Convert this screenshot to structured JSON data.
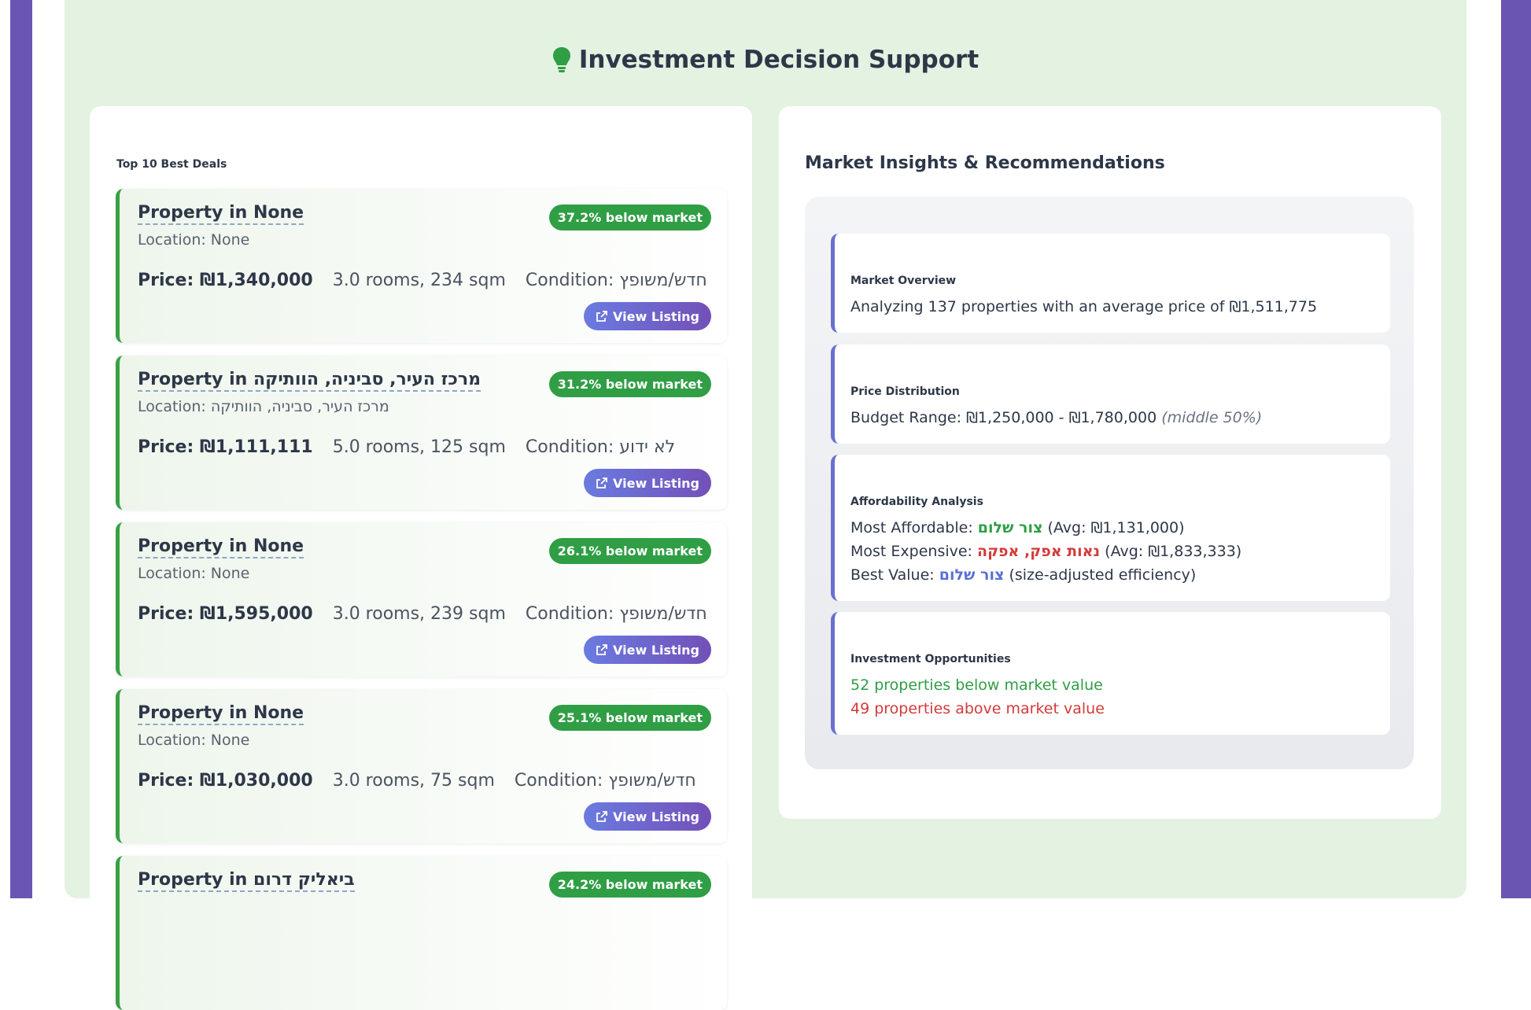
{
  "header": {
    "title": "Investment Decision Support"
  },
  "deals_section": {
    "title": "Top 10 Best Deals",
    "view_label": "View Listing",
    "items": [
      {
        "name": "Property in None",
        "location": "Location: None",
        "badge": "37.2% below market",
        "price": "Price: ₪1,340,000",
        "rooms": "3.0 rooms, 234 sqm",
        "condition": "Condition: חדש/משופץ"
      },
      {
        "name": "Property in מרכז העיר, סביניה, הוותיקה",
        "location": "Location: מרכז העיר, סביניה, הוותיקה",
        "badge": "31.2% below market",
        "price": "Price: ₪1,111,111",
        "rooms": "5.0 rooms, 125 sqm",
        "condition": "Condition: לא ידוע"
      },
      {
        "name": "Property in None",
        "location": "Location: None",
        "badge": "26.1% below market",
        "price": "Price: ₪1,595,000",
        "rooms": "3.0 rooms, 239 sqm",
        "condition": "Condition: חדש/משופץ"
      },
      {
        "name": "Property in None",
        "location": "Location: None",
        "badge": "25.1% below market",
        "price": "Price: ₪1,030,000",
        "rooms": "3.0 rooms, 75 sqm",
        "condition": "Condition: חדש/משופץ"
      },
      {
        "name": "Property in ביאליק דרום",
        "location": "",
        "badge": "24.2% below market",
        "price": "",
        "rooms": "",
        "condition": ""
      }
    ]
  },
  "insights": {
    "title": "Market Insights & Recommendations",
    "overview": {
      "head": "Market Overview",
      "text": "Analyzing 137 properties with an average price of ₪1,511,775"
    },
    "distribution": {
      "head": "Price Distribution",
      "text": "Budget Range: ₪1,250,000 - ₪1,780,000",
      "note": "(middle 50%)"
    },
    "affordability": {
      "head": "Affordability Analysis",
      "affordable_label": "Most Affordable:",
      "affordable_name": "צור שלום",
      "affordable_avg": "(Avg: ₪1,131,000)",
      "expensive_label": "Most Expensive:",
      "expensive_name": "נאות אפק, אפקה",
      "expensive_avg": "(Avg: ₪1,833,333)",
      "value_label": "Best Value:",
      "value_name": "צור שלום",
      "value_note": "(size-adjusted efficiency)"
    },
    "opportunities": {
      "head": "Investment Opportunities",
      "below": "52 properties below market value",
      "above": "49 properties above market value"
    }
  },
  "colors": {
    "accent_purple": "#6a55b3",
    "green": "#2f9e44",
    "red": "#d43a3a",
    "blue": "#5a6fd8",
    "panel_bg": "#e3f2e1"
  }
}
